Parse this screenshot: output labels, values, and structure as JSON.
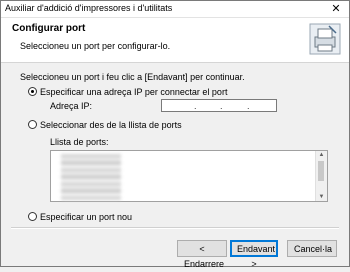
{
  "window": {
    "title": "Auxiliar d'addició d'impressores i d'utilitats",
    "close_glyph": "✕"
  },
  "header": {
    "title": "Configurar port",
    "subtitle": "Seleccioneu un port per configurar-lo.",
    "icon": "printer-wizard-icon"
  },
  "body": {
    "instruction": "Seleccioneu un port i feu clic a [Endavant] per continuar.",
    "option_ip": {
      "label": "Especificar una adreça IP per connectar el port",
      "selected": true
    },
    "ip_label": "Adreça IP:",
    "ip_value": [
      "",
      "",
      "",
      ""
    ],
    "ip_dots": [
      ".",
      ".",
      "."
    ],
    "option_list": {
      "label": "Seleccionar des de la llista de ports",
      "selected": false
    },
    "port_list_label": "Llista de ports:",
    "option_new": {
      "label": "Especificar un port nou",
      "selected": false
    }
  },
  "buttons": {
    "back": "< Endarrere",
    "next": "Endavant >",
    "cancel": "Cancel·la"
  },
  "colors": {
    "default_button_border": "#0078d7",
    "window_bg": "#f0f0f0",
    "header_bg": "#ffffff"
  }
}
